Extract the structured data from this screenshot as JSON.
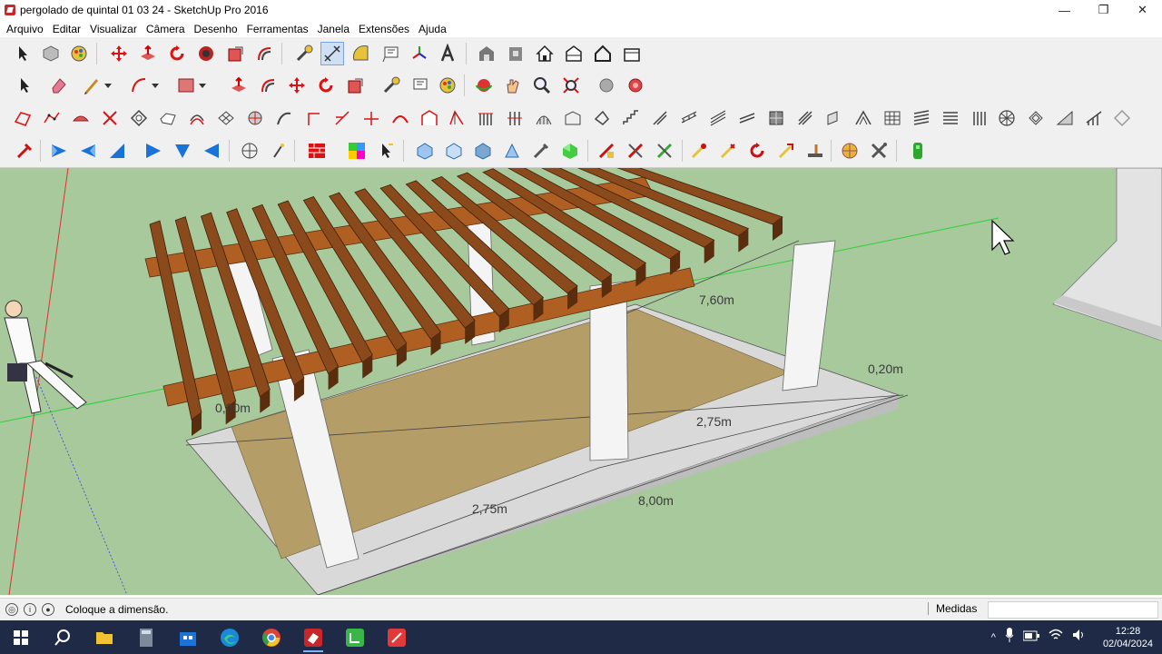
{
  "window": {
    "title": "pergolado de quintal 01 03 24 - SketchUp Pro 2016",
    "minimize_icon": "minimize-icon",
    "maximize_icon": "restore-icon",
    "close_icon": "close-icon"
  },
  "menu": [
    "Arquivo",
    "Editar",
    "Visualizar",
    "Câmera",
    "Desenho",
    "Ferramentas",
    "Janela",
    "Extensões",
    "Ajuda"
  ],
  "viewport": {
    "background": "#a7c99c",
    "dimensions": {
      "d1": "7,60m",
      "d2": "0,20m",
      "d3": "0,30m",
      "d4": "2,75m",
      "d5": "2,75m",
      "d6": "8,00m"
    }
  },
  "status": {
    "message": "Coloque a dimensão.",
    "measure_label": "Medidas",
    "measure_value": ""
  },
  "taskbar": {
    "time": "12:28",
    "date": "02/04/2024",
    "apps": [
      "start-icon",
      "search-icon",
      "file-explorer-icon",
      "calculator-icon",
      "store-icon",
      "edge-icon",
      "chrome-icon",
      "sketchup-icon",
      "layout-icon",
      "style-builder-icon"
    ]
  },
  "colors": {
    "accent_red": "#c8262b",
    "toolbar_bg": "#f0f0f0",
    "taskbar_bg": "#1f2b46",
    "wood": "#8b4a1c",
    "floor": "#b49d66"
  }
}
